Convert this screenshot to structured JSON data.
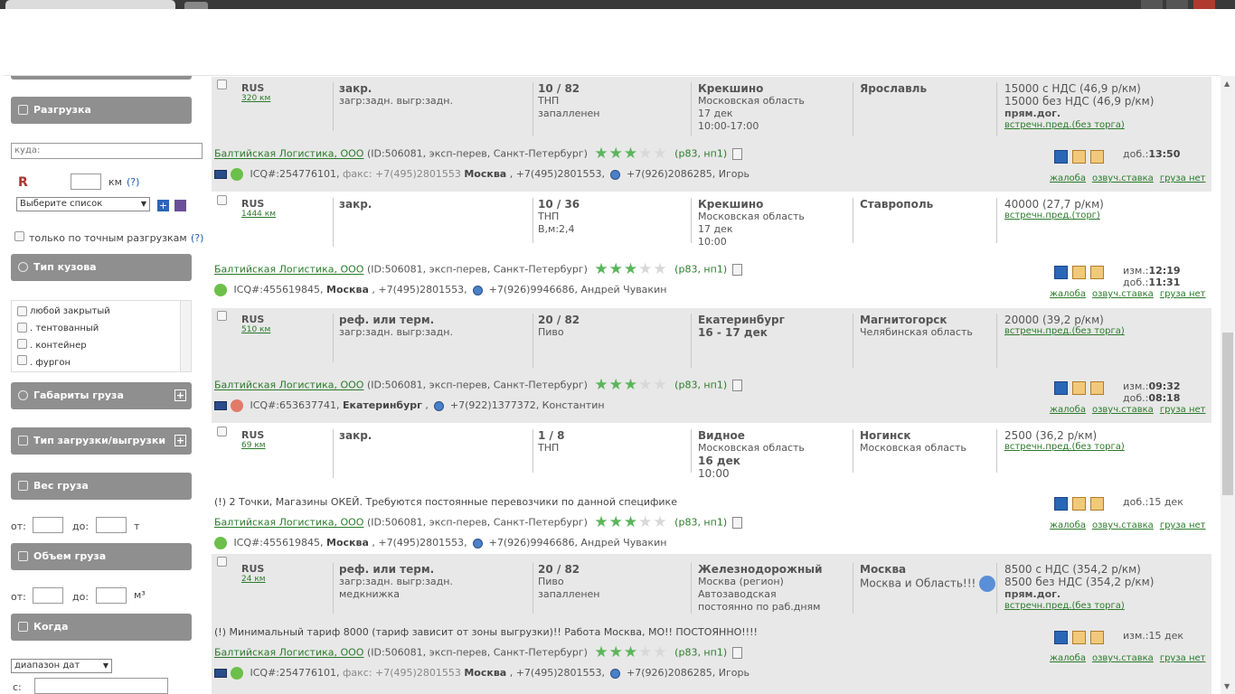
{
  "sidebar": {
    "unload_btn": "Разгрузка",
    "to_placeholder": "куда:",
    "km": "км",
    "q": "(?)",
    "list_select": "Выберите список",
    "exact_label": "только по точным разгрузкам",
    "body_type_btn": "Тип кузова",
    "body_types": [
      "любой закрытый",
      ". тентованный",
      ". контейнер",
      ". фургон"
    ],
    "dims_btn": "Габариты груза",
    "load_type_btn": "Тип загрузки/выгрузки",
    "weight_btn": "Вес груза",
    "from": "от:",
    "to": "до:",
    "t": "т",
    "volume_btn": "Объем груза",
    "m3": "м³",
    "when_btn": "Когда",
    "date_range": "диапазон дат",
    "c_label": "с:"
  },
  "cards": [
    {
      "country": "RUS",
      "distance": "320 км",
      "body": "закр.",
      "body2": "загр:задн. выгр:задн.",
      "cargo": "10 / 82",
      "cargo2": "ТНП",
      "cargo3": "запалленен",
      "from_city": "Крекшино",
      "from_region": "Московская область",
      "from_date": "17 дек",
      "from_time": "10:00-17:00",
      "to_city": "Ярославль",
      "to_region": "",
      "price1": "15000 с НДС (46,9 р/км)",
      "price2": "15000 без НДС (46,9 р/км)",
      "price3": "прям.дог.",
      "price_link": "встречн.пред.(без торга)",
      "note": "",
      "firm": "Балтийская Логистика, ООО",
      "firm_info": "(ID:506081, эксп-перев, Санкт-Петербург)",
      "rating": "(р83, нп1)",
      "icq": "ICQ#:254776101,",
      "fax": "факс: +7(495)2801553",
      "city": "Москва",
      "phones": ", +7(495)2801553,",
      "phone2": "+7(926)2086285, Игорь",
      "t1": "",
      "t1v": "",
      "t2": "доб.:",
      "t2v": "13:50",
      "actions": [
        "жалоба",
        "озвуч.ставка",
        "груза нет"
      ]
    },
    {
      "country": "RUS",
      "distance": "1444 км",
      "body": "закр.",
      "body2": "",
      "cargo": "10 / 36",
      "cargo2": "ТНП",
      "cargo3": "В,м:2,4",
      "from_city": "Крекшино",
      "from_region": "Московская область",
      "from_date": "17 дек",
      "from_time": "10:00",
      "to_city": "Ставрополь",
      "to_region": "",
      "price1": "40000 (27,7 р/км)",
      "price2": "",
      "price3": "",
      "price_link": "встречн.пред.(торг)",
      "note": "",
      "firm": "Балтийская Логистика, ООО",
      "firm_info": "(ID:506081, эксп-перев, Санкт-Петербург)",
      "rating": "(р83, нп1)",
      "icq": "ICQ#:455619845,",
      "fax": "",
      "city": "Москва",
      "phones": ", +7(495)2801553,",
      "phone2": "+7(926)9946686, Андрей Чувакин",
      "t1": "изм.:",
      "t1v": "12:19",
      "t2": "доб.:",
      "t2v": "11:31",
      "actions": [
        "жалоба",
        "озвуч.ставка",
        "груза нет"
      ]
    },
    {
      "country": "RUS",
      "distance": "510 км",
      "body": "реф. или терм.",
      "body2": "загр:задн. выгр:задн.",
      "cargo": "20 / 82",
      "cargo2": "Пиво",
      "cargo3": "",
      "from_city": "Екатеринбург",
      "from_region": "",
      "from_date": "16 - 17 дек",
      "from_time": "",
      "to_city": "Магнитогорск",
      "to_region": "Челябинская область",
      "price1": "20000 (39,2 р/км)",
      "price2": "",
      "price3": "",
      "price_link": "встречн.пред.(без торга)",
      "note": "",
      "firm": "Балтийская Логистика, ООО",
      "firm_info": "(ID:506081, эксп-перев, Санкт-Петербург)",
      "rating": "(р83, нп1)",
      "icq": "ICQ#:653637741,",
      "fax": "",
      "city": "Екатеринбург",
      "phones": ",",
      "phone2": "+7(922)1377372, Константин",
      "t1": "изм.:",
      "t1v": "09:32",
      "t2": "доб.:",
      "t2v": "08:18",
      "actions": [
        "жалоба",
        "озвуч.ставка",
        "груза нет"
      ]
    },
    {
      "country": "RUS",
      "distance": "69 км",
      "body": "закр.",
      "body2": "",
      "cargo": "1 / 8",
      "cargo2": "ТНП",
      "cargo3": "",
      "from_city": "Видное",
      "from_region": "Московская область",
      "from_date": "16 дек",
      "from_time": "10:00",
      "to_city": "Ногинск",
      "to_region": "Московская область",
      "price1": "2500 (36,2 р/км)",
      "price2": "",
      "price3": "",
      "price_link": "встречн.пред.(без торга)",
      "note": "(!) 2 Точки, Магазины ОКЕЙ. Требуются постоянные перевозчики по данной специфике",
      "firm": "Балтийская Логистика, ООО",
      "firm_info": "(ID:506081, эксп-перев, Санкт-Петербург)",
      "rating": "(р83, нп1)",
      "icq": "ICQ#:455619845,",
      "fax": "",
      "city": "Москва",
      "phones": ", +7(495)2801553,",
      "phone2": "+7(926)9946686, Андрей Чувакин",
      "t1": "",
      "t1v": "",
      "t2": "доб.:",
      "t2v": "15 дек",
      "actions": [
        "жалоба",
        "озвуч.ставка",
        "груза нет"
      ]
    },
    {
      "country": "RUS",
      "distance": "24 км",
      "body": "реф. или терм.",
      "body2": "загр:задн. выгр:задн.",
      "body3": "медкнижка",
      "cargo": "20 / 82",
      "cargo2": "Пиво",
      "cargo3": "запалленен",
      "from_city": "Железнодорожный",
      "from_region": "Москва (регион)",
      "from_date": "Автозаводская",
      "from_time": "постоянно по раб.дням",
      "to_city": "Москва",
      "to_region": "Москва и Область!!!",
      "price1": "8500 с НДС (354,2 р/км)",
      "price2": "8500 без НДС (354,2 р/км)",
      "price3": "прям.дог.",
      "price_link": "встречн.пред.(без торга)",
      "note": "(!) Минимальный тариф 8000 (тариф зависит от зоны выгрузки)!! Работа Москва, МО!! ПОСТОЯННО!!!!",
      "firm": "Балтийская Логистика, ООО",
      "firm_info": "(ID:506081, эксп-перев, Санкт-Петербург)",
      "rating": "(р83, нп1)",
      "icq": "ICQ#:254776101,",
      "fax": "факс: +7(495)2801553",
      "city": "Москва",
      "phones": ", +7(495)2801553,",
      "phone2": "+7(926)2086285, Игорь",
      "t1": "изм.:",
      "t1v": "15 дек",
      "t2": "",
      "t2v": "",
      "actions": [
        "жалоба",
        "озвуч.ставка",
        "груза нет"
      ]
    }
  ]
}
